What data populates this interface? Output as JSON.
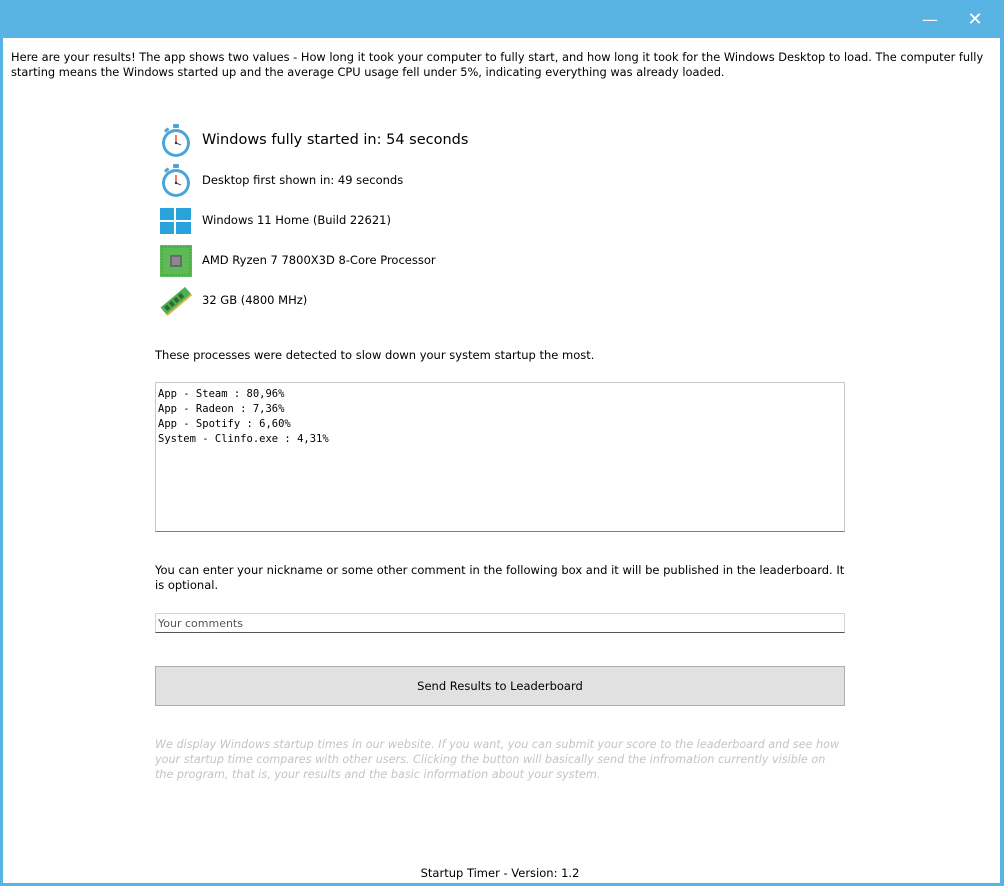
{
  "window": {
    "minimize_symbol": "—",
    "close_symbol": "✕"
  },
  "intro_text": "Here are your results! The app shows two values - How long it took your computer to fully start, and how long it took for the Windows Desktop to load. The computer fully starting means the Windows started up and the average CPU usage fell under 5%, indicating everything was already loaded.",
  "stats": {
    "fully_started": "Windows fully started in: 54 seconds",
    "desktop_shown": "Desktop first shown in: 49 seconds",
    "os": "Windows 11 Home (Build 22621)",
    "cpu": "AMD Ryzen 7 7800X3D 8-Core Processor",
    "ram": "32 GB (4800 MHz)"
  },
  "icons": {
    "stopwatch": "stopwatch-icon",
    "windows": "windows-logo-icon",
    "cpu": "cpu-chip-icon",
    "ram": "ram-module-icon"
  },
  "processes_label": "These processes were detected to slow down your system startup the most.",
  "processes": [
    "App - Steam : 80,96%",
    "App - Radeon : 7,36%",
    "App - Spotify : 6,60%",
    "System - Clinfo.exe : 4,31%"
  ],
  "comment_label": "You can enter your nickname or some other comment in the following box and it will be published in the leaderboard. It is optional.",
  "comment_placeholder": "Your comments",
  "send_button_label": "Send Results to Leaderboard",
  "disclaimer": "We display Windows startup times in our website. If you want, you can submit your score to the leaderboard and see how your startup time compares with other users. Clicking the button will basically send the infromation currently visible on the program, that is, your results and the basic information about your system.",
  "footer": "Startup Timer - Version: 1.2",
  "colors": {
    "titlebar": "#5ab4e3",
    "button_bg": "#e1e1e1",
    "disclaimer_text": "#c4c4c4"
  }
}
